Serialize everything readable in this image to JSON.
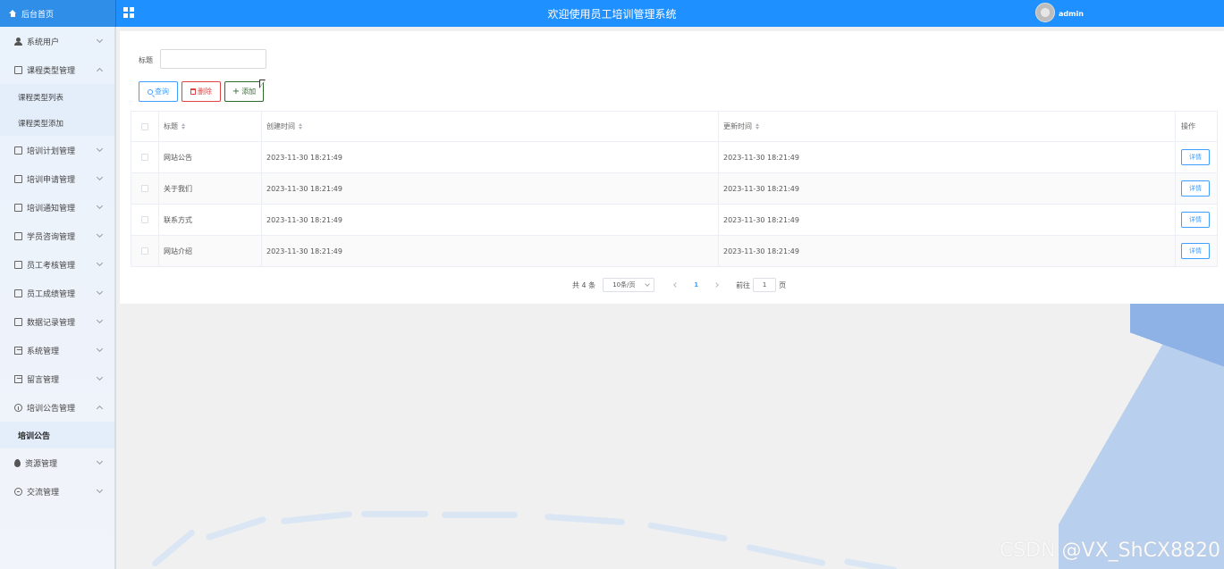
{
  "header": {
    "home_label": "后台首页",
    "title": "欢迎使用员工培训管理系统",
    "username": "admin"
  },
  "sidebar": {
    "items": [
      {
        "label": "系统用户",
        "icon": "user-icon",
        "expanded": false
      },
      {
        "label": "课程类型管理",
        "icon": "doc-icon",
        "expanded": true,
        "children": [
          "课程类型列表",
          "课程类型添加"
        ]
      },
      {
        "label": "培训计划管理",
        "icon": "doc-icon",
        "expanded": false
      },
      {
        "label": "培训申请管理",
        "icon": "doc-icon",
        "expanded": false
      },
      {
        "label": "培训通知管理",
        "icon": "doc-icon",
        "expanded": false
      },
      {
        "label": "学员咨询管理",
        "icon": "doc-icon",
        "expanded": false
      },
      {
        "label": "员工考核管理",
        "icon": "doc-icon",
        "expanded": false
      },
      {
        "label": "员工成绩管理",
        "icon": "doc-icon",
        "expanded": false
      },
      {
        "label": "数据记录管理",
        "icon": "doc-icon",
        "expanded": false
      },
      {
        "label": "系统管理",
        "icon": "image-icon",
        "expanded": false
      },
      {
        "label": "留言管理",
        "icon": "image-icon",
        "expanded": false
      },
      {
        "label": "培训公告管理",
        "icon": "info-icon",
        "expanded": true,
        "children": [
          "培训公告"
        ]
      },
      {
        "label": "资源管理",
        "icon": "pin-icon",
        "expanded": false
      },
      {
        "label": "交流管理",
        "icon": "chat-icon",
        "expanded": false
      }
    ]
  },
  "search": {
    "label": "标题",
    "value": ""
  },
  "toolbar": {
    "query_label": "查询",
    "delete_label": "删除",
    "add_label": "添加"
  },
  "table": {
    "headers": [
      "标题",
      "创建时间",
      "更新时间",
      "操作"
    ],
    "rows": [
      {
        "title": "网站公告",
        "created": "2023-11-30 18:21:49",
        "updated": "2023-11-30 18:21:49",
        "action": "详情"
      },
      {
        "title": "关于我们",
        "created": "2023-11-30 18:21:49",
        "updated": "2023-11-30 18:21:49",
        "action": "详情"
      },
      {
        "title": "联系方式",
        "created": "2023-11-30 18:21:49",
        "updated": "2023-11-30 18:21:49",
        "action": "详情"
      },
      {
        "title": "网站介绍",
        "created": "2023-11-30 18:21:49",
        "updated": "2023-11-30 18:21:49",
        "action": "详情"
      }
    ]
  },
  "pagination": {
    "total": "共 4 条",
    "page_size": "10条/页",
    "current_page": "1",
    "goto_label": "前往",
    "goto_value": "1",
    "page_suffix": "页"
  },
  "watermark": "CSDN @VX_ShCX8820",
  "colors": {
    "primary": "#1e90ff",
    "danger": "#e14343",
    "success": "#2d6a2d"
  }
}
